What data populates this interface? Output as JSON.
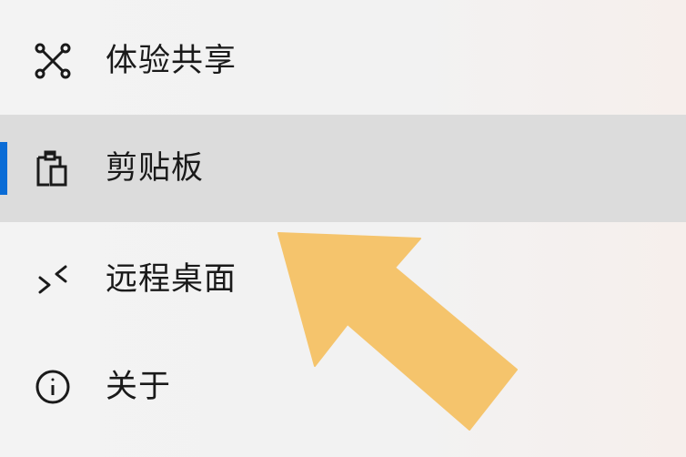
{
  "menu": {
    "items": [
      {
        "label": "体验共享",
        "icon": "share-network-icon",
        "selected": false
      },
      {
        "label": "剪贴板",
        "icon": "clipboard-icon",
        "selected": true
      },
      {
        "label": "远程桌面",
        "icon": "remote-desktop-icon",
        "selected": false
      },
      {
        "label": "关于",
        "icon": "info-icon",
        "selected": false
      }
    ]
  },
  "colors": {
    "accent": "#0a6cd6",
    "selected_bg": "#dcdcdc",
    "arrow": "#f5c46c"
  }
}
